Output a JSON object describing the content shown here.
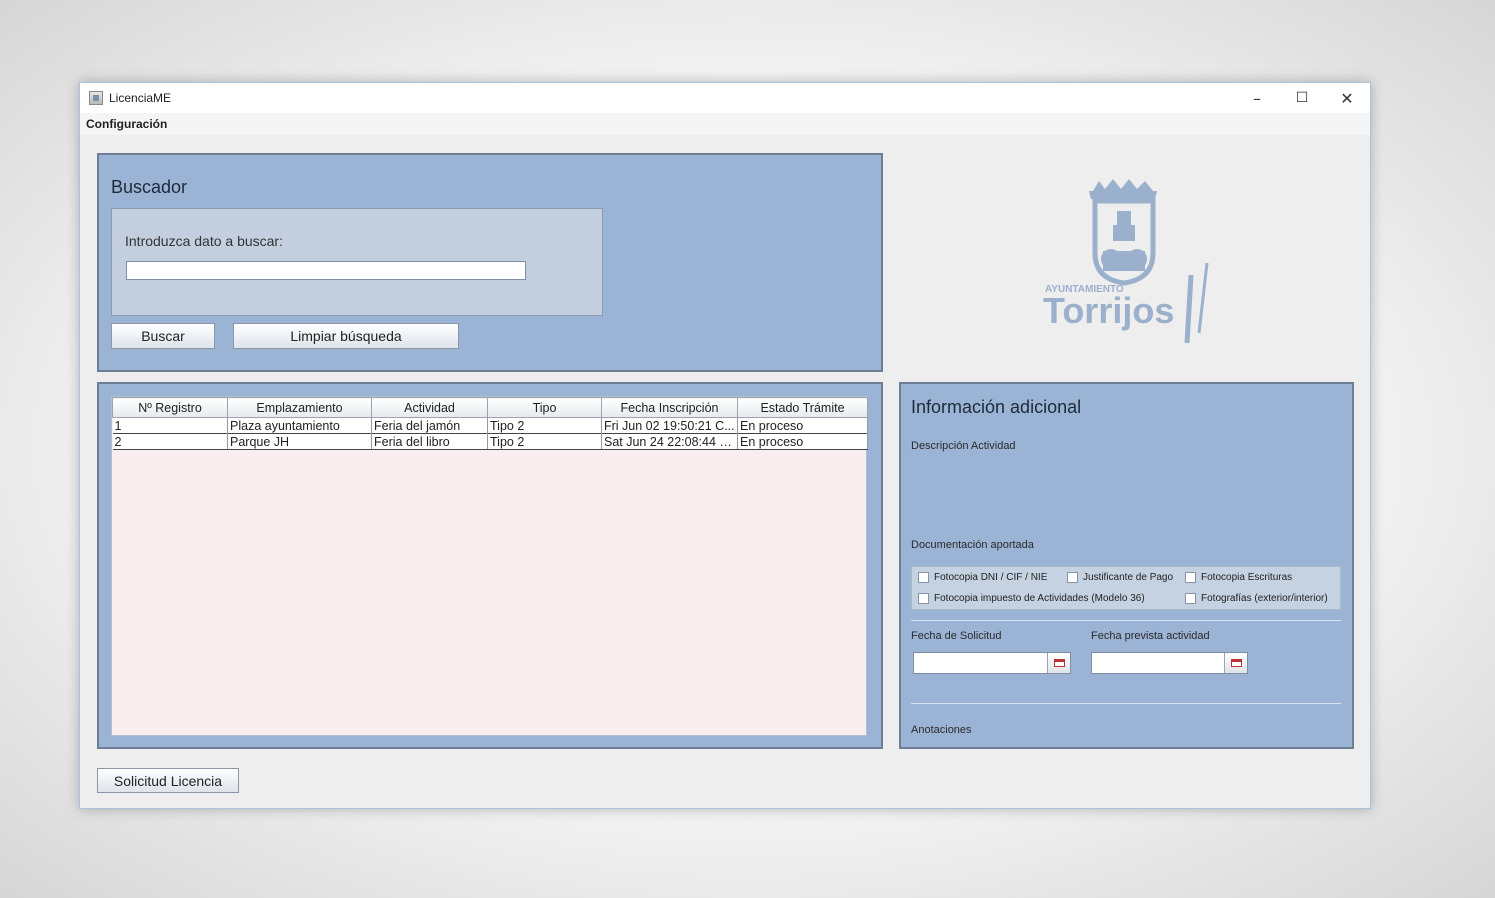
{
  "window": {
    "title": "LicenciaME",
    "controls": {
      "minimize": "–",
      "maximize": "☐",
      "close": "✕"
    }
  },
  "menubar": {
    "items": [
      "Configuración"
    ]
  },
  "search": {
    "title": "Buscador",
    "prompt": "Introduzca dato a buscar:",
    "value": "",
    "search_button": "Buscar",
    "clear_button": "Limpiar búsqueda"
  },
  "table": {
    "columns": [
      "Nº Registro",
      "Emplazamiento",
      "Actividad",
      "Tipo",
      "Fecha Inscripción",
      "Estado Trámite"
    ],
    "rows": [
      [
        "1",
        "Plaza ayuntamiento",
        "Feria del jamón",
        "Tipo 2",
        "Fri Jun 02 19:50:21 C...",
        "En proceso"
      ],
      [
        "2",
        "Parque JH",
        "Feria del libro",
        "Tipo 2",
        "Sat Jun 24 22:08:44 C...",
        "En proceso"
      ]
    ]
  },
  "logo": {
    "small_text": "AYUNTAMIENTO",
    "big_text": "Torrijos",
    "accent_color": "#9bb0cc"
  },
  "info": {
    "title": "Información adicional",
    "description_label": "Descripción Actividad",
    "documentation_label": "Documentación aportada",
    "documents": [
      "Fotocopia DNI / CIF / NIE",
      "Justificante de Pago",
      "Fotocopia Escrituras",
      "Fotocopia impuesto de Actividades (Modelo 36)",
      "Fotografías (exterior/interior)"
    ],
    "request_date_label": "Fecha de Solicitud",
    "request_date_value": "",
    "planned_date_label": "Fecha prevista actividad",
    "planned_date_value": "",
    "notes_label": "Anotaciones"
  },
  "footer": {
    "request_button": "Solicitud Licencia"
  },
  "colors": {
    "panel": "#9bb4d5",
    "panel_border": "#6d7f96",
    "window_bg": "#eeeeee"
  },
  "icons": [
    "app-icon",
    "minimize-icon",
    "maximize-icon",
    "close-icon",
    "calendar-icon",
    "checkbox",
    "torrijos-logo"
  ]
}
